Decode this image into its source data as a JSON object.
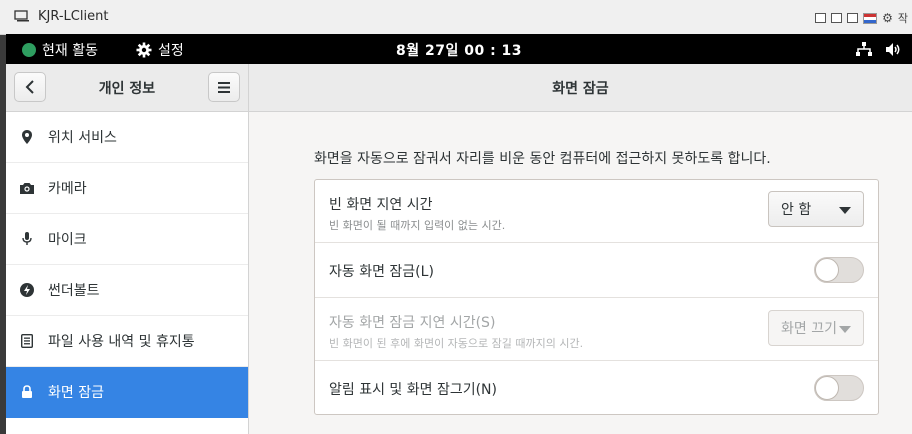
{
  "client": {
    "title": "KJR-LClient",
    "controls_text": "작"
  },
  "topbar": {
    "activities": "현재 활동",
    "settings": "설정",
    "clock": "8월 27일  00 : 13"
  },
  "header": {
    "sidebar_title": "개인 정보",
    "page_title": "화면 잠금"
  },
  "sidebar": {
    "items": [
      {
        "label": "위치 서비스",
        "icon": "location-pin-icon"
      },
      {
        "label": "카메라",
        "icon": "camera-icon"
      },
      {
        "label": "마이크",
        "icon": "microphone-icon"
      },
      {
        "label": "썬더볼트",
        "icon": "thunderbolt-icon"
      },
      {
        "label": "파일 사용 내역 및 휴지통",
        "icon": "file-history-icon"
      },
      {
        "label": "화면 잠금",
        "icon": "lock-icon",
        "active": true
      }
    ]
  },
  "main": {
    "description": "화면을 자동으로 잠궈서 자리를 비운 동안 컴퓨터에 접근하지 못하도록 합니다.",
    "rows": {
      "blank_delay": {
        "title": "빈 화면 지연 시간",
        "subtitle": "빈 화면이 될 때까지 입력이 없는 시간.",
        "value": "안 함"
      },
      "auto_lock": {
        "title": "자동 화면 잠금(L)",
        "enabled": false
      },
      "auto_lock_delay": {
        "title": "자동 화면 잠금 지연 시간(S)",
        "subtitle": "빈 화면이 된 후에 화면이 자동으로 잠길 때까지의 시간.",
        "value": "화면 끄기"
      },
      "notifications_on_lock": {
        "title": "알림 표시 및 화면 잠그기(N)",
        "enabled": false
      }
    }
  },
  "colors": {
    "accent": "#3584e4",
    "topbar": "#000000"
  }
}
